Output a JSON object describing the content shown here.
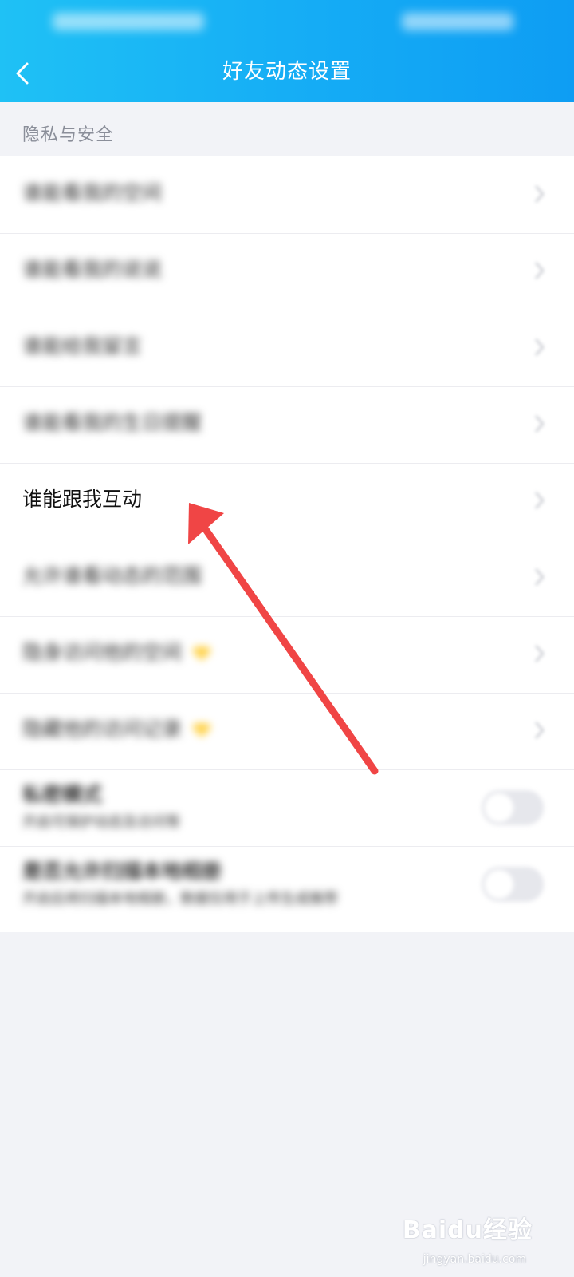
{
  "header": {
    "title": "好友动态设置",
    "back_icon": "chevron-left-icon",
    "background": "#15acf5"
  },
  "section": {
    "title": "隐私与安全"
  },
  "items": [
    {
      "label": "谁能看我的空间",
      "blurred": true
    },
    {
      "label": "谁能看我的说说",
      "blurred": true
    },
    {
      "label": "谁能给我留言",
      "blurred": true
    },
    {
      "label": "谁能看我的生日提醒",
      "blurred": true
    },
    {
      "label": "谁能跟我互动",
      "blurred": false
    },
    {
      "label": "允许谁看动态的范围",
      "blurred": true
    },
    {
      "label": "隐身访问他的空间",
      "blurred": true,
      "badge": "diamond-icon"
    },
    {
      "label": "隐藏他的访问记录",
      "blurred": true,
      "badge": "diamond-icon"
    }
  ],
  "toggles": [
    {
      "label": "私密模式",
      "sub": "开启可保护动态及访问等",
      "on": false
    },
    {
      "label": "是否允许扫描本地相册",
      "sub": "开启后将扫描本地相册，数据仅用于上传生成推荐",
      "on": false
    }
  ],
  "annotation": {
    "color": "#f04545"
  },
  "watermark": {
    "text": "Baidu经验",
    "sub": "jingyan.baidu.com"
  }
}
